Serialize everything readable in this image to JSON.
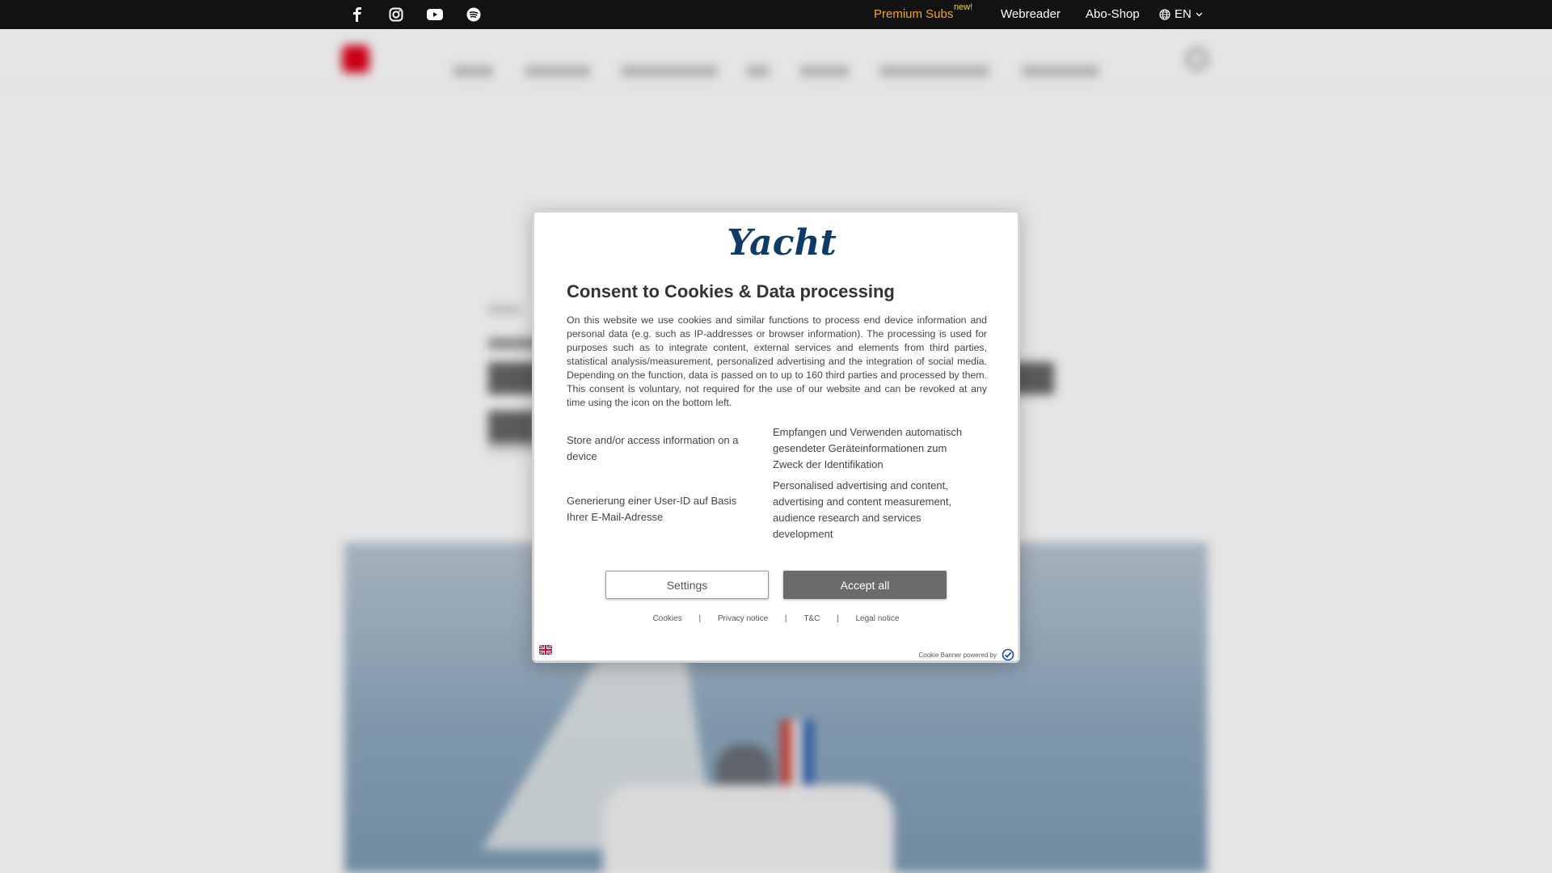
{
  "topbar": {
    "social": [
      {
        "name": "facebook-icon"
      },
      {
        "name": "instagram-icon"
      },
      {
        "name": "youtube-icon"
      },
      {
        "name": "spotify-icon"
      }
    ],
    "premium_label": "Premium Subs",
    "new_badge": "new!",
    "webreader_label": "Webreader",
    "aboshop_label": "Abo-Shop",
    "language": "EN",
    "colors": {
      "background": "#121212",
      "premium": "#f5a623",
      "badge": "#f5d33a"
    }
  },
  "modal": {
    "logo_text": "Yacht",
    "title": "Consent to Cookies & Data processing",
    "body": "On this website we use cookies and similar functions to process end device information and personal data (e.g. such as IP-addresses or browser information). The processing is used for purposes such as to integrate content, external services and elements from third parties, statistical analysis/measurement, personalized advertising and the integration of social media. Depending on the function, data is passed on to up to 160 third parties and processed by them. This consent is voluntary, not required for the use of our website and can be revoked at any time using the icon on the bottom left.",
    "purposes": [
      "Store and/or access information on a device",
      "Empfangen und Verwenden automatisch gesendeter Geräteinformationen zum Zweck der Identifikation",
      "Generierung einer User-ID auf Basis Ihrer E-Mail-Adresse",
      "Personalised advertising and content, advertising and content measurement, audience research and services development"
    ],
    "settings_label": "Settings",
    "accept_label": "Accept all",
    "footer_links": [
      "Cookies",
      "Privacy notice",
      "T&C",
      "Legal notice"
    ],
    "separator": "|",
    "powered_by": "Cookie Banner powered by",
    "colors": {
      "logo": "#0d3a66",
      "accept_bg": "#6b6b6b"
    }
  }
}
